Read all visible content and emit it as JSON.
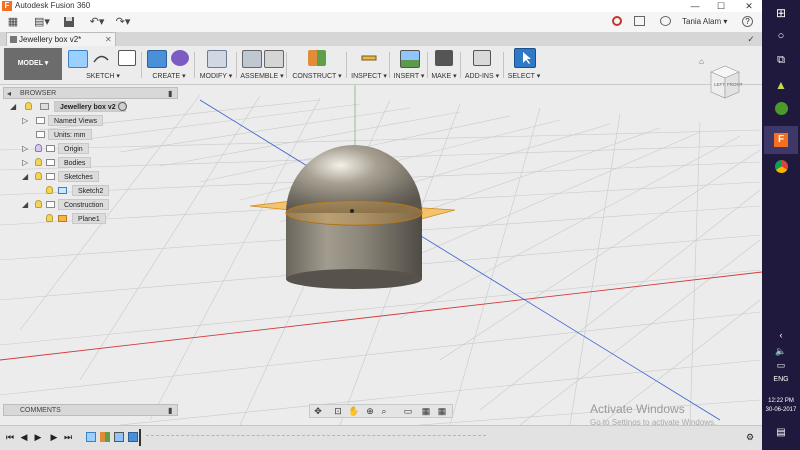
{
  "app": {
    "title": "Autodesk Fusion 360",
    "icon": "F"
  },
  "window_controls": {
    "minimize": "—",
    "maximize": "☐",
    "close": "✕"
  },
  "quick_access": {
    "grid": "▦",
    "file": "▤▾",
    "save": "💾",
    "undo": "↶▾",
    "redo": "↷▾",
    "user": "Tania Alam ▾",
    "help": "?"
  },
  "document_tab": {
    "label": "Jewellery box v2*",
    "close": "✕"
  },
  "toolbar": {
    "model": "MODEL ▾",
    "groups": [
      {
        "label": "SKETCH ▾"
      },
      {
        "label": "CREATE ▾"
      },
      {
        "label": "MODIFY ▾"
      },
      {
        "label": "ASSEMBLE ▾"
      },
      {
        "label": "CONSTRUCT ▾"
      },
      {
        "label": "INSPECT ▾"
      },
      {
        "label": "INSERT ▾"
      },
      {
        "label": "MAKE ▾"
      },
      {
        "label": "ADD-INS ▾"
      },
      {
        "label": "SELECT ▾"
      }
    ]
  },
  "browser": {
    "title": "BROWSER",
    "root": "Jewellery box v2",
    "items": {
      "named_views": "Named Views",
      "units": "Units: mm",
      "origin": "Origin",
      "bodies": "Bodies",
      "sketches": "Sketches",
      "sketch2": "Sketch2",
      "construction": "Construction",
      "plane1": "Plane1"
    }
  },
  "comments": {
    "title": "COMMENTS"
  },
  "view_cube": {
    "left": "LEFT",
    "front": "FRONT"
  },
  "watermark": {
    "line1": "Activate Windows",
    "line2": "Go to Settings to activate Windows."
  },
  "taskbar": {
    "lang": "ENG",
    "time": "12:22 PM",
    "date": "30-06-2017"
  },
  "colors": {
    "accent": "#f36f21",
    "plane": "#f5b544",
    "taskbar": "#1f1a3d",
    "x_axis": "#d23a3a",
    "z_axis": "#3a5fd2"
  }
}
